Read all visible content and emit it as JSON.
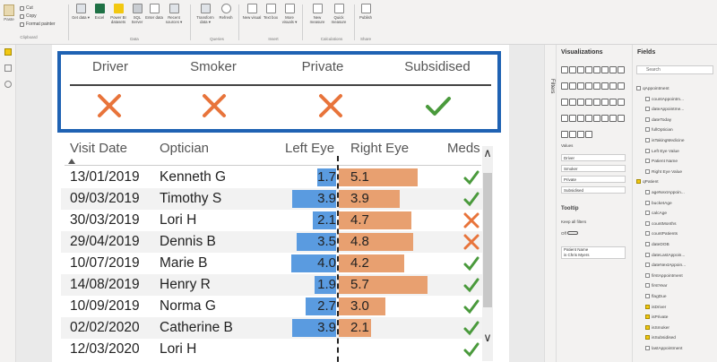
{
  "ribbon": {
    "clipboard": {
      "paste": "Paste",
      "cut": "Cut",
      "copy": "Copy",
      "format_painter": "Format painter",
      "group": "Clipboard"
    },
    "data": {
      "get_data": "Get data ▾",
      "excel": "Excel",
      "power_bi": "Power BI datasets",
      "sql": "SQL Server",
      "enter": "Enter data",
      "recent": "Recent sources ▾",
      "group": "Data"
    },
    "queries": {
      "transform": "Transform data ▾",
      "refresh": "Refresh",
      "group": "Queries"
    },
    "insert": {
      "new_visual": "New visual",
      "text_box": "Text box",
      "more_visuals": "More visuals ▾",
      "group": "Insert"
    },
    "calculations": {
      "new_measure": "New measure",
      "quick_measure": "Quick measure",
      "group": "Calculations"
    },
    "share": {
      "publish": "Publish",
      "group": "Share"
    }
  },
  "card": {
    "headers": [
      "Driver",
      "Smoker",
      "Private",
      "Subsidised"
    ],
    "icons": [
      "cross-icon",
      "cross-icon",
      "cross-icon",
      "check-icon"
    ],
    "colors": {
      "border": "#1f62b3",
      "cross": "#e8743b",
      "check": "#4a9a3c"
    }
  },
  "table": {
    "columns": [
      "Visit Date",
      "Optician",
      "Left Eye",
      "Right Eye",
      "Meds"
    ],
    "rows": [
      {
        "date": "13/01/2019",
        "optician": "Kenneth G",
        "left": "1.7",
        "right": "5.1",
        "meds": "check"
      },
      {
        "date": "09/03/2019",
        "optician": "Timothy S",
        "left": "3.9",
        "right": "3.9",
        "meds": "check"
      },
      {
        "date": "30/03/2019",
        "optician": "Lori H",
        "left": "2.1",
        "right": "4.7",
        "meds": "cross"
      },
      {
        "date": "29/04/2019",
        "optician": "Dennis B",
        "left": "3.5",
        "right": "4.8",
        "meds": "cross"
      },
      {
        "date": "10/07/2019",
        "optician": "Marie B",
        "left": "4.0",
        "right": "4.2",
        "meds": "check"
      },
      {
        "date": "14/08/2019",
        "optician": "Henry R",
        "left": "1.9",
        "right": "5.7",
        "meds": "check"
      },
      {
        "date": "10/09/2019",
        "optician": "Norma G",
        "left": "2.7",
        "right": "3.0",
        "meds": "check"
      },
      {
        "date": "02/02/2020",
        "optician": "Catherine B",
        "left": "3.9",
        "right": "2.1",
        "meds": "check"
      },
      {
        "date": "12/03/2020",
        "optician": "Lori H",
        "left": "",
        "right": "",
        "meds": "check"
      }
    ],
    "colors": {
      "left_bar": "#5a9be0",
      "right_bar": "#e8a070",
      "stripe": "#f2f2f2"
    }
  },
  "filters_pane": {
    "label": "Filters"
  },
  "viz_pane": {
    "title": "Visualizations",
    "values_label": "Values",
    "wells": [
      "Driver",
      "Smoker",
      "Private",
      "Subsidised"
    ],
    "tooltip": "Tooltip",
    "keep_filters": "Keep all filters",
    "off": "Off",
    "patient_name": "Patient Name",
    "patient_value": "is Chris Myers"
  },
  "fields_pane": {
    "title": "Fields",
    "search_placeholder": "Search",
    "items": [
      {
        "label": "qAppointment",
        "table": true,
        "checked": false
      },
      {
        "label": "countAppointm...",
        "table": false,
        "checked": false
      },
      {
        "label": "dateAppointme...",
        "table": false,
        "checked": false
      },
      {
        "label": "dateToday",
        "table": false,
        "checked": false
      },
      {
        "label": "fullOptician",
        "table": false,
        "checked": false
      },
      {
        "label": "isTakingMedicine",
        "table": false,
        "checked": false
      },
      {
        "label": "Left Eye Value",
        "table": false,
        "checked": false
      },
      {
        "label": "Patient Name",
        "table": false,
        "checked": false
      },
      {
        "label": "Right Eye Value",
        "table": false,
        "checked": false
      },
      {
        "label": "qPatient",
        "table": true,
        "checked": true
      },
      {
        "label": "ageNextAppoin...",
        "table": false,
        "checked": false
      },
      {
        "label": "bucketAge",
        "table": false,
        "checked": false
      },
      {
        "label": "calcAge",
        "table": false,
        "checked": false
      },
      {
        "label": "countMonths",
        "table": false,
        "checked": false
      },
      {
        "label": "countPatients",
        "table": false,
        "checked": false
      },
      {
        "label": "dateDOB",
        "table": false,
        "checked": false
      },
      {
        "label": "dateLastAppoin...",
        "table": false,
        "checked": false
      },
      {
        "label": "dateNextAppoin...",
        "table": false,
        "checked": false
      },
      {
        "label": "firstAppointment",
        "table": false,
        "checked": false
      },
      {
        "label": "firstYear",
        "table": false,
        "checked": false
      },
      {
        "label": "flagDue",
        "table": false,
        "checked": false
      },
      {
        "label": "isDriver",
        "table": false,
        "checked": true
      },
      {
        "label": "isPrivate",
        "table": false,
        "checked": true
      },
      {
        "label": "isSmoker",
        "table": false,
        "checked": true
      },
      {
        "label": "isSubsidised",
        "table": false,
        "checked": true
      },
      {
        "label": "lastAppointment",
        "table": false,
        "checked": false
      }
    ]
  }
}
